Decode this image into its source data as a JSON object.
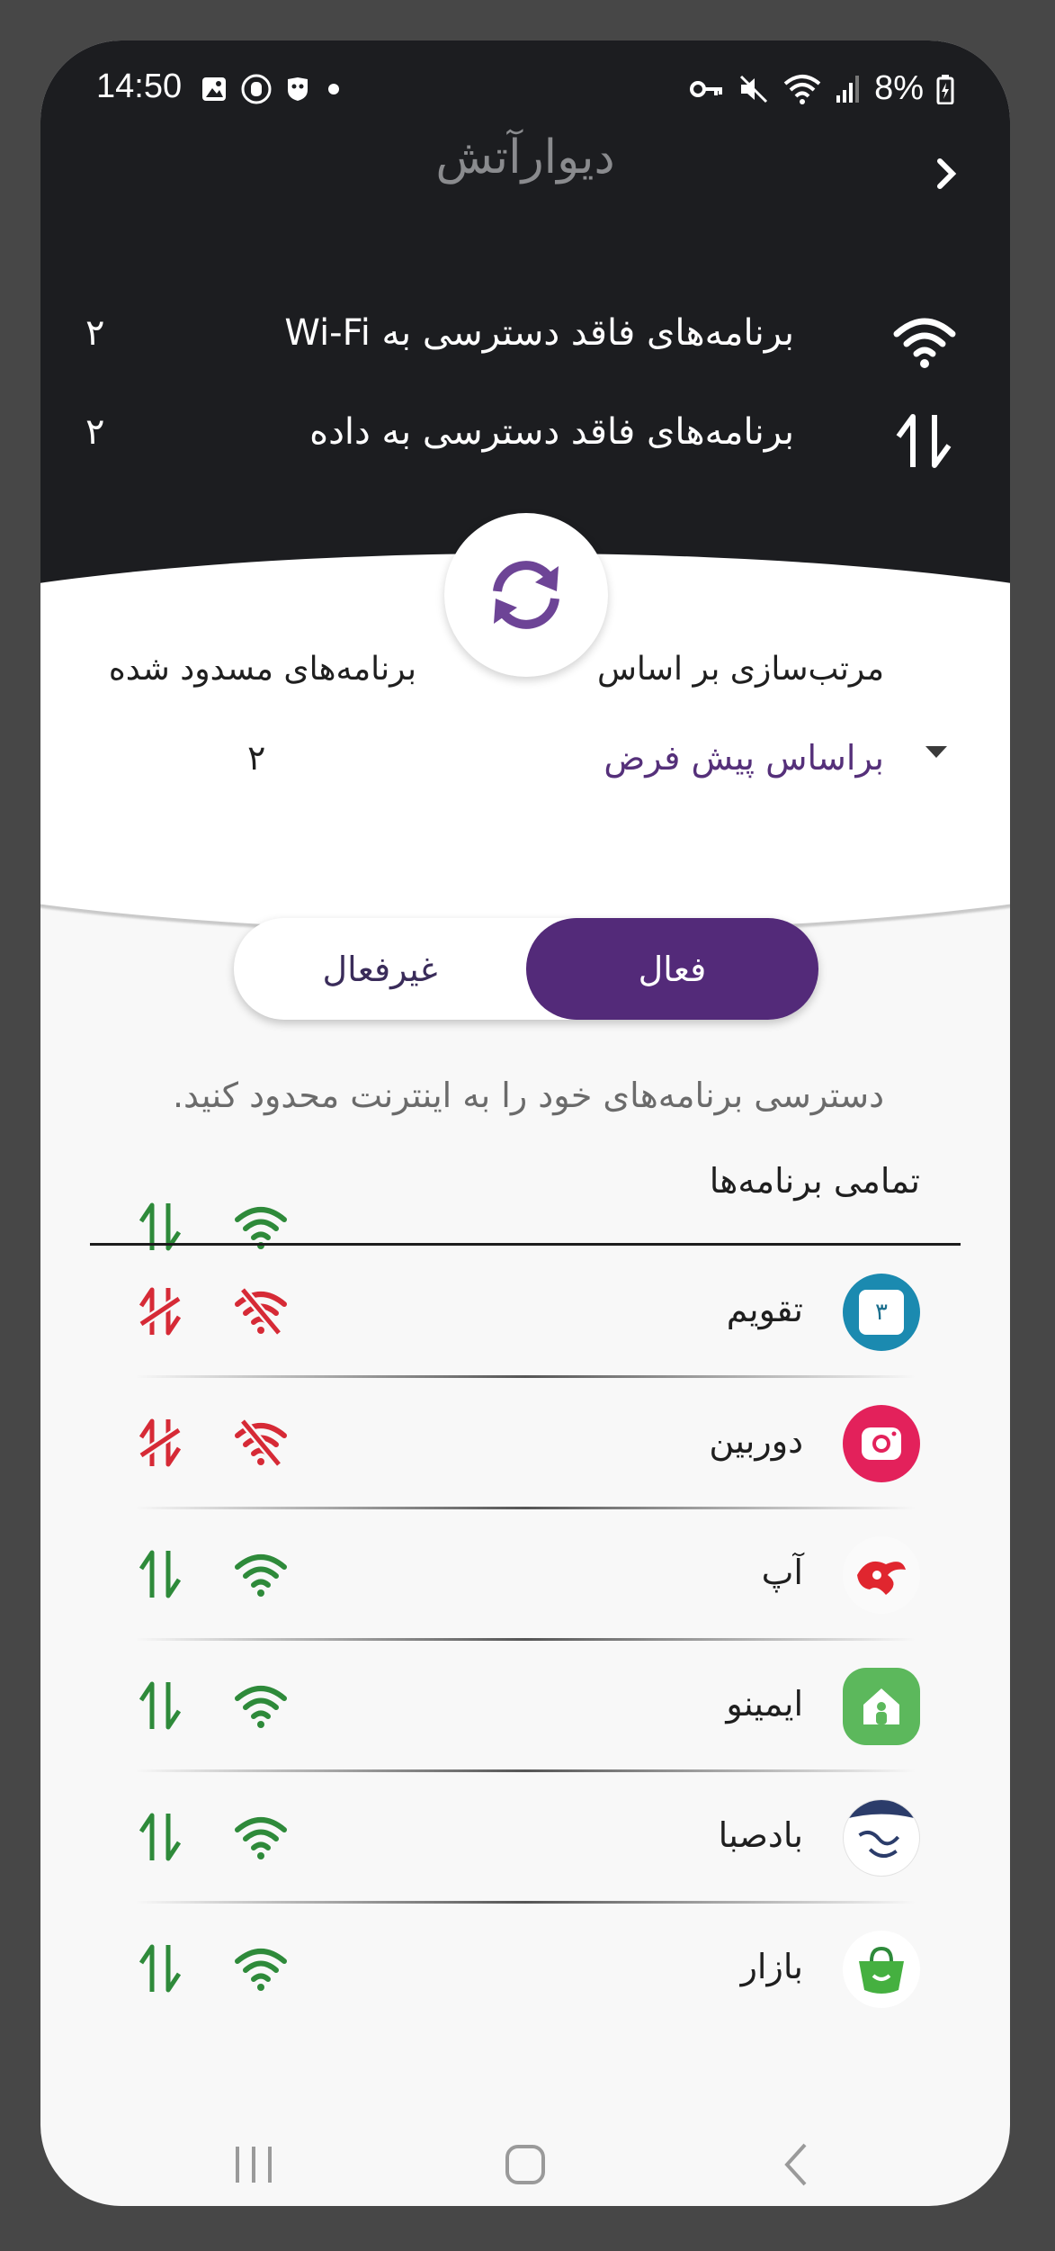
{
  "status_bar": {
    "time": "14:50",
    "battery": "8%",
    "left_icons": [
      "gallery-icon",
      "whatsapp-icon",
      "shield-icon",
      "dot-icon"
    ],
    "right_icons": [
      "key-icon",
      "mute-icon",
      "wifi-icon",
      "signal-icon",
      "battery-icon"
    ]
  },
  "header": {
    "title": "دیوارآتش",
    "back_icon": "chevron-right-icon"
  },
  "summary": [
    {
      "label": "برنامه‌های فاقد دسترسی به Wi-Fi",
      "count": "۲",
      "icon": "wifi-icon"
    },
    {
      "label": "برنامه‌های فاقد دسترسی به داده",
      "count": "۲",
      "icon": "data-arrows-icon"
    }
  ],
  "sort": {
    "label": "مرتب‌سازی بر اساس",
    "value": "براساس پیش فرض"
  },
  "blocked": {
    "label": "برنامه‌های مسدود شده",
    "count": "۲"
  },
  "toggle": {
    "active_label": "فعال",
    "inactive_label": "غیرفعال"
  },
  "hint": "دسترسی برنامه‌های خود را به اینترنت محدود کنید.",
  "all_apps_label": "تمامی برنامه‌ها",
  "colors": {
    "accent": "#532a79",
    "allowed": "#2e8a3a",
    "blocked": "#d62a36",
    "dark_header": "#1c1d20"
  },
  "apps": [
    {
      "name": "تقویم",
      "icon": "calendar-icon",
      "icon_text": "۳",
      "wifi_blocked": true,
      "data_blocked": true
    },
    {
      "name": "دوربین",
      "icon": "camera-icon",
      "wifi_blocked": true,
      "data_blocked": true
    },
    {
      "name": "آپ",
      "icon": "ap-logo-icon",
      "wifi_blocked": false,
      "data_blocked": false
    },
    {
      "name": "ایمینو",
      "icon": "imino-home-icon",
      "wifi_blocked": false,
      "data_blocked": false
    },
    {
      "name": "بادصبا",
      "icon": "badesaba-logo-icon",
      "wifi_blocked": false,
      "data_blocked": false
    },
    {
      "name": "بازار",
      "icon": "bazaar-bag-icon",
      "wifi_blocked": false,
      "data_blocked": false
    }
  ]
}
